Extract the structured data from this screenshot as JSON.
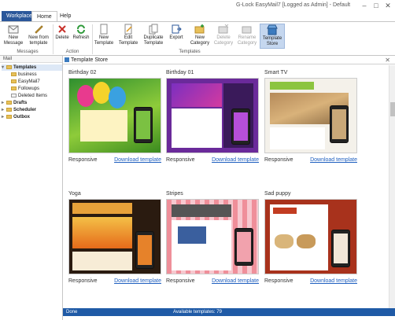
{
  "app": {
    "window_title": "G-Lock EasyMail7 [Logged as Admin] - Default",
    "tabs": [
      "Workplace",
      "Home",
      "Help"
    ]
  },
  "ribbon": {
    "groups": {
      "messages": "Messages",
      "action": "Action",
      "templates": "Templates"
    },
    "buttons": {
      "new_message": "New Message",
      "new_from_template": "New from template",
      "delete": "Delete",
      "refresh": "Refresh",
      "new_template": "New Template",
      "edit_template": "Edit Template",
      "duplicate_template": "Duplicate Template",
      "export": "Export",
      "new_category": "New Category",
      "delete_category": "Delete Category",
      "rename_category": "Rename Category",
      "template_store": "Template Store"
    }
  },
  "sidebar": {
    "header": "Mail",
    "items": [
      "Templates",
      "business",
      "EasyMail7",
      "Followups",
      "Deleted Items",
      "Drafts",
      "Scheduler",
      "Outbox"
    ]
  },
  "store": {
    "title": "Template Store",
    "templates": [
      {
        "name": "Birthday 02",
        "tag": "Responsive",
        "action": "Download template"
      },
      {
        "name": "Birthday 01",
        "tag": "Responsive",
        "action": "Download template"
      },
      {
        "name": "Smart TV",
        "tag": "Responsive",
        "action": "Download template"
      },
      {
        "name": "Yoga",
        "tag": "Responsive",
        "action": "Download template"
      },
      {
        "name": "Stripes",
        "tag": "Responsive",
        "action": "Download template"
      },
      {
        "name": "Sad puppy",
        "tag": "Responsive",
        "action": "Download template"
      }
    ]
  },
  "status": {
    "left": "Done",
    "mid": "Available templates: 79"
  },
  "colors": {
    "accent": "#2b579a",
    "status_bar": "#1f5aa6",
    "link": "#1f5fbf"
  }
}
